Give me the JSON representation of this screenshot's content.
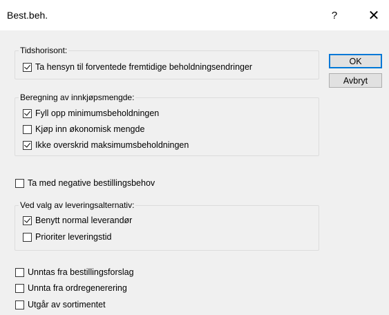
{
  "window": {
    "title": "Best.beh.",
    "help_label": "?",
    "close_label": "✕"
  },
  "buttons": {
    "ok": "OK",
    "cancel": "Avbryt"
  },
  "groups": {
    "time_horizon": {
      "label": "Tidshorisont:",
      "options": [
        {
          "label": "Ta hensyn til forventede fremtidige beholdningsendringer",
          "checked": true
        }
      ]
    },
    "purchase_quantity": {
      "label": "Beregning av innkjøpsmengde:",
      "options": [
        {
          "label": "Fyll opp minimumsbeholdningen",
          "checked": true
        },
        {
          "label": "Kjøp inn økonomisk mengde",
          "checked": false
        },
        {
          "label": "Ikke overskrid maksimumsbeholdningen",
          "checked": true
        }
      ]
    },
    "delivery_alternative": {
      "label": "Ved valg av leveringsalternativ:",
      "options": [
        {
          "label": "Benytt normal leverandør",
          "checked": true
        },
        {
          "label": "Prioriter leveringstid",
          "checked": false
        }
      ]
    }
  },
  "standalone": {
    "negative_needs": {
      "label": "Ta med negative bestillingsbehov",
      "checked": false
    },
    "bottom": [
      {
        "label": "Unntas fra bestillingsforslag",
        "checked": false
      },
      {
        "label": "Unnta fra ordregenerering",
        "checked": false
      },
      {
        "label": "Utgår av sortimentet",
        "checked": false
      }
    ]
  }
}
